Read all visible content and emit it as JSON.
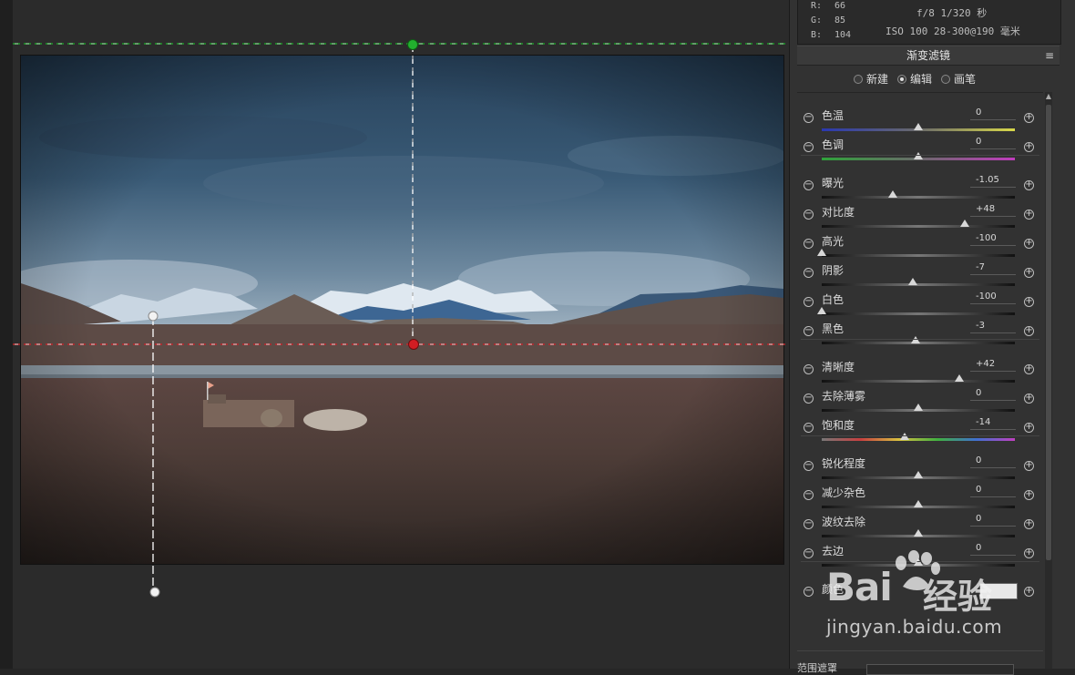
{
  "info": {
    "rgb": [
      {
        "key": "R:",
        "value": "66"
      },
      {
        "key": "G:",
        "value": "85"
      },
      {
        "key": "B:",
        "value": "104"
      }
    ],
    "camera_line1": "f/8  1/320 秒",
    "camera_line2": "ISO 100  28-300@190 毫米"
  },
  "panel": {
    "title": "渐变滤镜",
    "modes": [
      {
        "label": "新建",
        "selected": false
      },
      {
        "label": "编辑",
        "selected": true
      },
      {
        "label": "画笔",
        "selected": false
      }
    ],
    "groups": [
      [
        {
          "label": "色温",
          "value": "0",
          "position": 0.5,
          "track": "temp"
        },
        {
          "label": "色调",
          "value": "0",
          "position": 0.5,
          "track": "tint"
        }
      ],
      [
        {
          "label": "曝光",
          "value": "-1.05",
          "position": 0.37,
          "track": "gray"
        },
        {
          "label": "对比度",
          "value": "+48",
          "position": 0.74,
          "track": "gray"
        },
        {
          "label": "高光",
          "value": "-100",
          "position": 0.0,
          "track": "gray"
        },
        {
          "label": "阴影",
          "value": "-7",
          "position": 0.47,
          "track": "gray"
        },
        {
          "label": "白色",
          "value": "-100",
          "position": 0.0,
          "track": "gray"
        },
        {
          "label": "黑色",
          "value": "-3",
          "position": 0.485,
          "track": "gray"
        }
      ],
      [
        {
          "label": "清晰度",
          "value": "+42",
          "position": 0.71,
          "track": "gray"
        },
        {
          "label": "去除薄雾",
          "value": "0",
          "position": 0.5,
          "track": "gray"
        },
        {
          "label": "饱和度",
          "value": "-14",
          "position": 0.43,
          "track": "sat"
        }
      ],
      [
        {
          "label": "锐化程度",
          "value": "0",
          "position": 0.5,
          "track": "gray"
        },
        {
          "label": "减少杂色",
          "value": "0",
          "position": 0.5,
          "track": "gray"
        },
        {
          "label": "波纹去除",
          "value": "0",
          "position": 0.5,
          "track": "gray"
        },
        {
          "label": "去边",
          "value": "0",
          "position": 0.5,
          "track": "gray"
        }
      ],
      [
        {
          "label": "颜色",
          "value": "",
          "position": null,
          "track": "none"
        }
      ]
    ],
    "bottom_label": "范围遮罩"
  },
  "watermark": {
    "logo": "Bai",
    "logo_cn": "经验",
    "url": "jingyan.baidu.com"
  },
  "colors": {
    "green_guide": "#1f9a2a",
    "red_guide": "#c0262b",
    "panel_bg": "#323232",
    "canvas_bg": "#2b2b2b"
  }
}
